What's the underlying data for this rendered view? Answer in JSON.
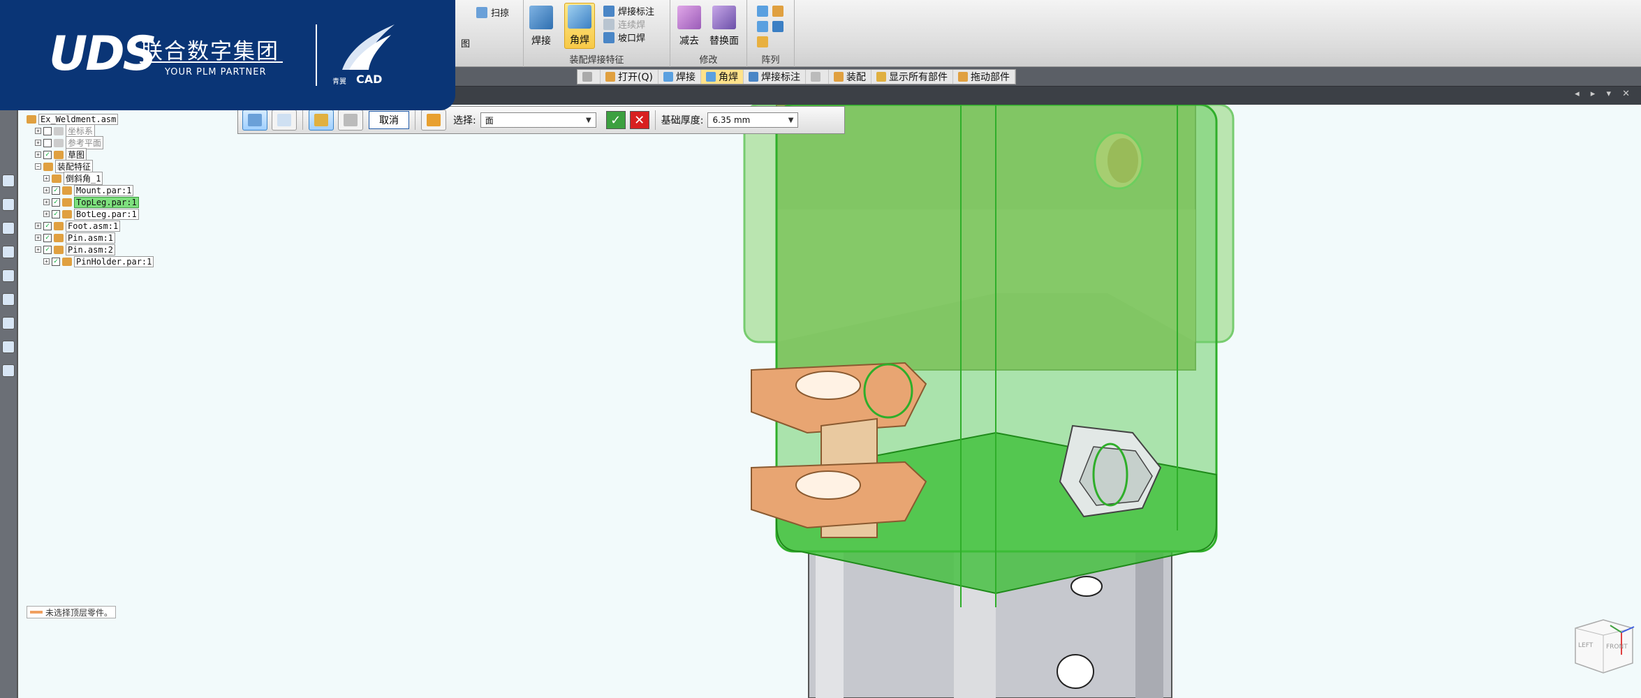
{
  "ribbon": {
    "partial": {
      "sweep": "扫掠",
      "partial_label": "图"
    },
    "weld_group": {
      "weld": "焊接",
      "fillet": "角焊",
      "weld_mark": "焊接标注",
      "continuous": "连续焊",
      "groove": "坡口焊",
      "label": "装配焊接特征"
    },
    "modify_group": {
      "subtract": "减去",
      "replace_face": "替换面",
      "label": "修改"
    },
    "pattern_group": {
      "label": "阵列"
    }
  },
  "quickbar": {
    "items": [
      {
        "label": "",
        "disabled": true
      },
      {
        "label": "打开(Q)",
        "disabled": false
      },
      {
        "label": "焊接",
        "disabled": false
      },
      {
        "label": "角焊",
        "disabled": false,
        "active": true
      },
      {
        "label": "焊接标注",
        "disabled": false
      },
      {
        "label": "",
        "disabled": true
      },
      {
        "label": "装配",
        "disabled": false
      },
      {
        "label": "显示所有部件",
        "disabled": false
      },
      {
        "label": "拖动部件",
        "disabled": false
      }
    ]
  },
  "tree": {
    "root": "Ex_Weldment.asm",
    "nodes": [
      {
        "label": "坐标系",
        "indent": 1,
        "checked": false,
        "dim": true
      },
      {
        "label": "参考平面",
        "indent": 1,
        "checked": false,
        "dim": true
      },
      {
        "label": "草图",
        "indent": 1,
        "checked": true
      },
      {
        "label": "装配特征",
        "indent": 1,
        "expanded": true
      },
      {
        "label": "倒斜角_1",
        "indent": 2
      },
      {
        "label": "Mount.par:1",
        "indent": 2,
        "checked": true
      },
      {
        "label": "TopLeg.par:1",
        "indent": 2,
        "checked": true,
        "selected": true
      },
      {
        "label": "BotLeg.par:1",
        "indent": 2,
        "checked": true
      },
      {
        "label": "Foot.asm:1",
        "indent": 1,
        "checked": true
      },
      {
        "label": "Pin.asm:1",
        "indent": 1,
        "checked": true
      },
      {
        "label": "Pin.asm:2",
        "indent": 1,
        "checked": true
      },
      {
        "label": "PinHolder.par:1",
        "indent": 2,
        "checked": true
      }
    ]
  },
  "command_bar": {
    "cancel": "取消",
    "select_label": "选择:",
    "select_value": "面",
    "thickness_label": "基础厚度:",
    "thickness_value": "6.35 mm"
  },
  "status": {
    "text": "未选择顶层零件。"
  },
  "logo": {
    "brand": "UDS",
    "company": "联合数字集团",
    "tagline": "YOUR PLM PARTNER",
    "product": "CAD",
    "product_prefix": "青翼"
  },
  "viewcube": {
    "face_left": "LEFT",
    "face_front": "FRONT"
  },
  "colors": {
    "logo_bg": "#0a3576",
    "selection_green": "#5ac83c",
    "mount_orange": "#e0a070"
  }
}
